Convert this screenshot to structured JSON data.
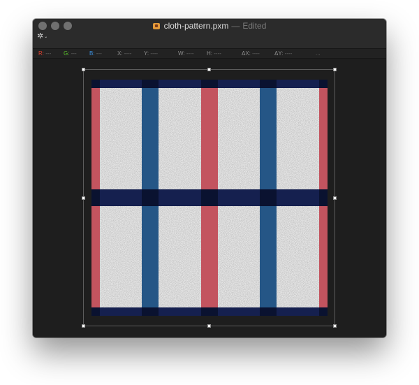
{
  "window": {
    "title": "cloth-pattern.pxm",
    "separator": "—",
    "status": "Edited"
  },
  "icons": {
    "document": "pixelmator-document-icon",
    "gear": "gear-icon",
    "gear_glyph": "✲",
    "chevron_glyph": "⌄"
  },
  "info": {
    "r_label": "R:",
    "r_value": "---",
    "g_label": "G:",
    "g_value": "---",
    "b_label": "B:",
    "b_value": "---",
    "x_label": "X:",
    "x_value": "----",
    "y_label": "Y:",
    "y_value": "----",
    "w_label": "W:",
    "w_value": "----",
    "h_label": "H:",
    "h_value": "----",
    "dx_label": "ΔX:",
    "dx_value": "----",
    "dy_label": "ΔY:",
    "dy_value": "----",
    "more": "..."
  },
  "colors": {
    "window_bg": "#1e1e1e",
    "fabric_white": "#f1f1f1",
    "stripe_navy": "#15204f",
    "stripe_blue": "#255686",
    "stripe_red": "#c3545f",
    "stripe_overlap_dark": "#0a1230"
  }
}
